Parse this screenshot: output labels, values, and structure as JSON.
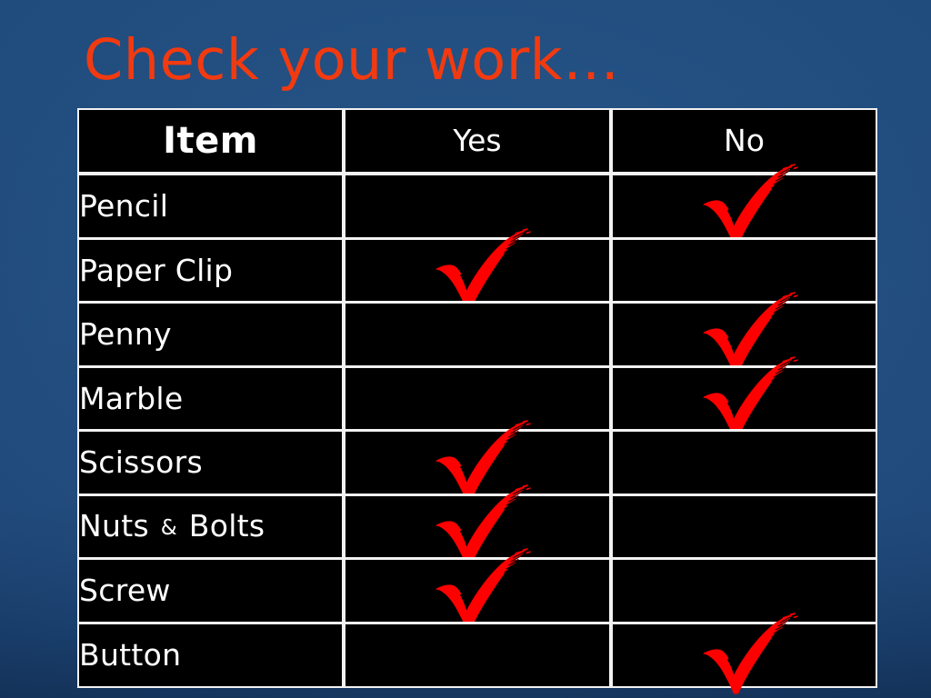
{
  "slide": {
    "title": "Check your work…",
    "background_color": "#1f4a7c",
    "title_color": "#f23a10",
    "table_border_color": "#f2f2f2",
    "cell_background": "#000000",
    "check_color": "#ff0000"
  },
  "table": {
    "columns": [
      {
        "key": "item",
        "label": "Item",
        "align": "center"
      },
      {
        "key": "yes",
        "label": "Yes",
        "align": "center"
      },
      {
        "key": "no",
        "label": "No",
        "align": "center"
      }
    ],
    "rows": [
      {
        "item": "Pencil",
        "yes": "",
        "no": "check-mark"
      },
      {
        "item": "Paper Clip",
        "yes": "check-mark",
        "no": ""
      },
      {
        "item": "Penny",
        "yes": "",
        "no": "check-mark"
      },
      {
        "item": "Marble",
        "yes": "",
        "no": "check-mark"
      },
      {
        "item": "Scissors",
        "yes": "check-mark",
        "no": ""
      },
      {
        "item": "Nuts & Bolts",
        "yes": "check-mark",
        "no": ""
      },
      {
        "item": "Screw",
        "yes": "check-mark",
        "no": ""
      },
      {
        "item": "Button",
        "yes": "",
        "no": "check-mark"
      }
    ],
    "item_parts": [
      {
        "pre": "Pencil",
        "amp": "",
        "post": ""
      },
      {
        "pre": "Paper Clip",
        "amp": "",
        "post": ""
      },
      {
        "pre": "Penny",
        "amp": "",
        "post": ""
      },
      {
        "pre": "Marble",
        "amp": "",
        "post": ""
      },
      {
        "pre": "Scissors",
        "amp": "",
        "post": ""
      },
      {
        "pre": "Nuts ",
        "amp": "&",
        "post": " Bolts"
      },
      {
        "pre": "Screw",
        "amp": "",
        "post": ""
      },
      {
        "pre": "Button",
        "amp": "",
        "post": ""
      }
    ]
  }
}
